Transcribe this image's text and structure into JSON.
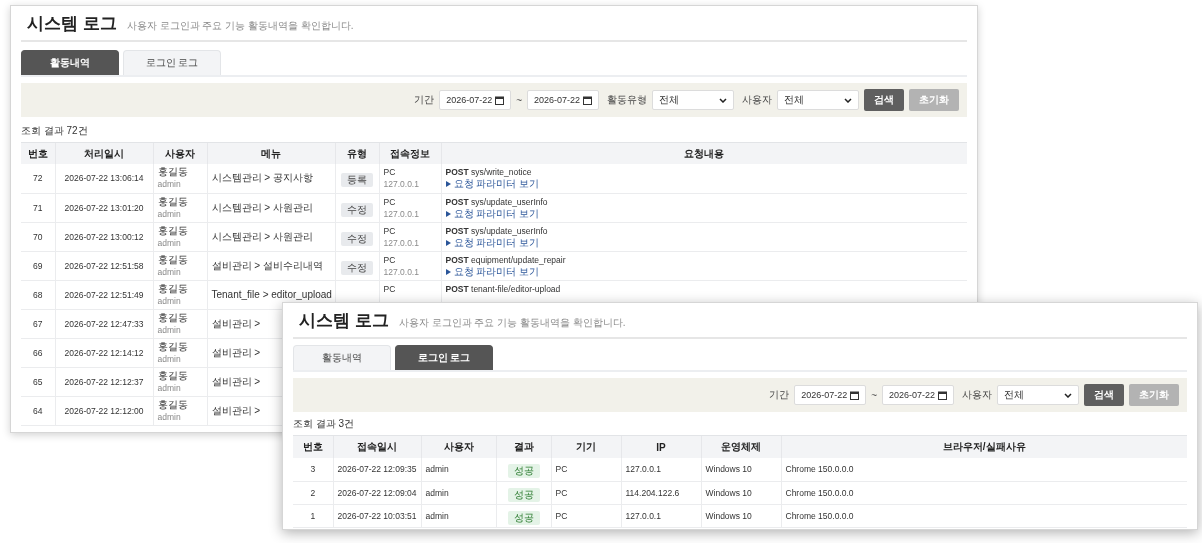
{
  "activity_log_window": {
    "title": "시스템 로그",
    "subtitle": "사용자 로그인과 주요 기능 활동내역을 확인합니다.",
    "tabs": [
      {
        "label": "활동내역",
        "selected": true
      },
      {
        "label": "로그인 로그",
        "selected": false
      }
    ],
    "filters": [
      {
        "kind": "date_range",
        "label": "기간",
        "from": "2026-07-22",
        "separator": "~",
        "to": "2026-07-22"
      },
      {
        "kind": "select",
        "label": "활동유형",
        "value": "전체"
      },
      {
        "kind": "select",
        "label": "사용자",
        "value": "전체"
      }
    ],
    "buttons": [
      {
        "label": "검색",
        "disabled": false
      },
      {
        "label": "초기화",
        "disabled": true
      }
    ],
    "result_count": "조회 결과 72건",
    "table": {
      "columns": [
        "번호",
        "처리일시",
        "사용자",
        "메뉴",
        "유형",
        "접속정보",
        "요청내용"
      ],
      "rows": [
        {
          "no": "72",
          "datetime": "2026-07-22 13:06:14",
          "user_name": "홍길동",
          "user_id": "admin",
          "menu": "시스템관리 > 공지사항",
          "type": "등록",
          "device": "PC",
          "ip": "127.0.0.1",
          "request": "**POST** sys/write_notice",
          "param_link": "요청 파라미터 보기"
        },
        {
          "no": "71",
          "datetime": "2026-07-22 13:01:20",
          "user_name": "홍길동",
          "user_id": "admin",
          "menu": "시스템관리 > 사원관리",
          "type": "수정",
          "device": "PC",
          "ip": "127.0.0.1",
          "request": "**POST** sys/update_userInfo",
          "param_link": "요청 파라미터 보기"
        },
        {
          "no": "70",
          "datetime": "2026-07-22 13:00:12",
          "user_name": "홍길동",
          "user_id": "admin",
          "menu": "시스템관리 > 사원관리",
          "type": "수정",
          "device": "PC",
          "ip": "127.0.0.1",
          "request": "**POST** sys/update_userInfo",
          "param_link": "요청 파라미터 보기"
        },
        {
          "no": "69",
          "datetime": "2026-07-22 12:51:58",
          "user_name": "홍길동",
          "user_id": "admin",
          "menu": "설비관리 > 설비수리내역",
          "type": "수정",
          "device": "PC",
          "ip": "127.0.0.1",
          "request": "**POST** equipment/update_repair",
          "param_link": "요청 파라미터 보기"
        },
        {
          "no": "68",
          "datetime": "2026-07-22 12:51:49",
          "user_name": "홍길동",
          "user_id": "admin",
          "menu": "Tenant_file > editor_upload",
          "device": "PC",
          "request": "**POST** tenant-file/editor-upload"
        },
        {
          "no": "67",
          "datetime": "2026-07-22 12:47:33",
          "user_name": "홍길동",
          "user_id": "admin",
          "menu": "설비관리 >"
        },
        {
          "no": "66",
          "datetime": "2026-07-22 12:14:12",
          "user_name": "홍길동",
          "user_id": "admin",
          "menu": "설비관리 >"
        },
        {
          "no": "65",
          "datetime": "2026-07-22 12:12:37",
          "user_name": "홍길동",
          "user_id": "admin",
          "menu": "설비관리 >"
        },
        {
          "no": "64",
          "datetime": "2026-07-22 12:12:00",
          "user_name": "홍길동",
          "user_id": "admin",
          "menu": "설비관리 >"
        }
      ]
    }
  },
  "login_log_window": {
    "title": "시스템 로그",
    "subtitle": "사용자 로그인과 주요 기능 활동내역을 확인합니다.",
    "tabs": [
      {
        "label": "활동내역",
        "selected": false
      },
      {
        "label": "로그인 로그",
        "selected": true
      }
    ],
    "filters": [
      {
        "kind": "date_range",
        "label": "기간",
        "from": "2026-07-22",
        "separator": "~",
        "to": "2026-07-22"
      },
      {
        "kind": "select",
        "label": "사용자",
        "value": "전체"
      }
    ],
    "buttons": [
      {
        "label": "검색",
        "disabled": false
      },
      {
        "label": "초기화",
        "disabled": true
      }
    ],
    "result_count": "조회 결과 3건",
    "table": {
      "columns": [
        "번호",
        "접속일시",
        "사용자",
        "결과",
        "기기",
        "IP",
        "운영체제",
        "브라우저/실패사유"
      ],
      "rows": [
        {
          "no": "3",
          "datetime": "2026-07-22 12:09:35",
          "user": "admin",
          "result": "성공",
          "device": "PC",
          "ip": "127.0.0.1",
          "os": "Windows 10",
          "browser": "Chrome 150.0.0.0"
        },
        {
          "no": "2",
          "datetime": "2026-07-22 12:09:04",
          "user": "admin",
          "result": "성공",
          "device": "PC",
          "ip": "114.204.122.6",
          "os": "Windows 10",
          "browser": "Chrome 150.0.0.0"
        },
        {
          "no": "1",
          "datetime": "2026-07-22 10:03:51",
          "user": "admin",
          "result": "성공",
          "device": "PC",
          "ip": "127.0.0.1",
          "os": "Windows 10",
          "browser": "Chrome 150.0.0.0"
        }
      ]
    }
  }
}
